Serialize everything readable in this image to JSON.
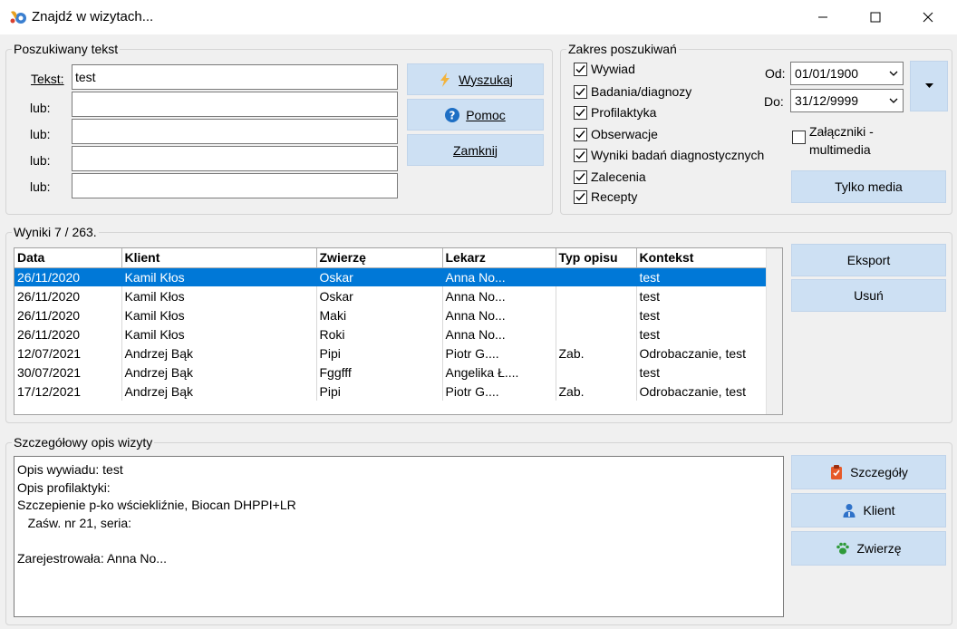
{
  "window": {
    "title": "Znajdź w wizytach...",
    "icons": [
      "app-logo-icon",
      "minimize-icon",
      "maximize-icon",
      "close-icon"
    ]
  },
  "search_text": {
    "legend": "Poszukiwany tekst",
    "fields": [
      {
        "label": "Tekst:",
        "value": "test"
      },
      {
        "label": "lub:",
        "value": ""
      },
      {
        "label": "lub:",
        "value": ""
      },
      {
        "label": "lub:",
        "value": ""
      },
      {
        "label": "lub:",
        "value": ""
      }
    ],
    "buttons": {
      "search": {
        "label": "Wyszukaj",
        "icon": "lightning-icon"
      },
      "help": {
        "label": "Pomoc",
        "icon": "help-icon"
      },
      "close": {
        "label": "Zamknij"
      }
    }
  },
  "scope": {
    "legend": "Zakres poszukiwań",
    "checkboxes": [
      {
        "label": "Wywiad",
        "checked": true
      },
      {
        "label": "Badania/diagnozy",
        "checked": true
      },
      {
        "label": "Profilaktyka",
        "checked": true
      },
      {
        "label": "Obserwacje",
        "checked": true
      },
      {
        "label": "Wyniki badań diagnostycznych",
        "checked": true
      },
      {
        "label": "Zalecenia",
        "checked": true
      },
      {
        "label": "Recepty",
        "checked": true
      }
    ],
    "date_from": {
      "label": "Od:",
      "value": "01/01/1900"
    },
    "date_to": {
      "label": "Do:",
      "value": "31/12/9999"
    },
    "attachments": {
      "label_line1": "Załączniki -",
      "label_line2": "multimedia",
      "checked": false
    },
    "media_only_label": "Tylko media",
    "dropdown_icon": "caret-down-icon"
  },
  "results": {
    "legend": "Wyniki 7 / 263.",
    "columns": [
      "Data",
      "Klient",
      "Zwierzę",
      "Lekarz",
      "Typ opisu",
      "Kontekst"
    ],
    "rows": [
      [
        "26/11/2020",
        "Kamil Kłos",
        "Oskar",
        "Anna No...",
        "",
        "test"
      ],
      [
        "26/11/2020",
        "Kamil Kłos",
        "Oskar",
        "Anna No...",
        "",
        "test"
      ],
      [
        "26/11/2020",
        "Kamil Kłos",
        "Maki",
        "Anna No...",
        "",
        "test"
      ],
      [
        "26/11/2020",
        "Kamil Kłos",
        "Roki",
        "Anna No...",
        "",
        "test"
      ],
      [
        "12/07/2021",
        "Andrzej Bąk",
        "Pipi",
        "Piotr G....",
        "Zab.",
        "Odrobaczanie, test"
      ],
      [
        "30/07/2021",
        "Andrzej Bąk",
        "Fggfff",
        "Angelika Ł....",
        "",
        "test"
      ],
      [
        "17/12/2021",
        "Andrzej Bąk",
        "Pipi",
        "Piotr G....",
        "Zab.",
        "Odrobaczanie, test"
      ]
    ],
    "selected_row": 0,
    "export_label": "Eksport",
    "delete_label": "Usuń"
  },
  "details": {
    "legend": "Szczegółowy opis wizyty",
    "lines": [
      "Opis wywiadu: test",
      "Opis profilaktyki:",
      "Szczepienie p-ko wściekliźnie, Biocan DHPPI+LR",
      "   Zaśw. nr 21, seria:",
      "",
      "Zarejestrowała: Anna No..."
    ],
    "buttons": {
      "details": {
        "label": "Szczegóły",
        "icon": "clipboard-icon"
      },
      "client": {
        "label": "Klient",
        "icon": "person-icon"
      },
      "animal": {
        "label": "Zwierzę",
        "icon": "paw-icon"
      }
    }
  },
  "colors": {
    "button_bg": "#cde0f3",
    "selection": "#0078d7",
    "window_bg": "#f0f0f0"
  }
}
